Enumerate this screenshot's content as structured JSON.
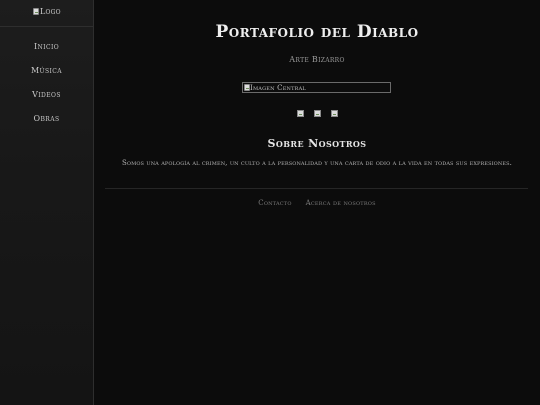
{
  "sidebar": {
    "logo_alt": "Logo",
    "items": [
      {
        "label": "Inicio"
      },
      {
        "label": "Música"
      },
      {
        "label": "Videos"
      },
      {
        "label": "Obras"
      }
    ]
  },
  "main": {
    "title": "Portafolio del Diablo",
    "subtitle": "Arte Bizarro",
    "central_image_alt": "Imagen Central",
    "about": {
      "heading": "Sobre Nosotros",
      "text": "Somos una apología al crimen, un culto a la personalidad y una carta de odio a la vida en todas sus expresiones."
    }
  },
  "footer": {
    "links": [
      {
        "label": "Contacto"
      },
      {
        "label": "Acerca de nosotros"
      }
    ]
  }
}
